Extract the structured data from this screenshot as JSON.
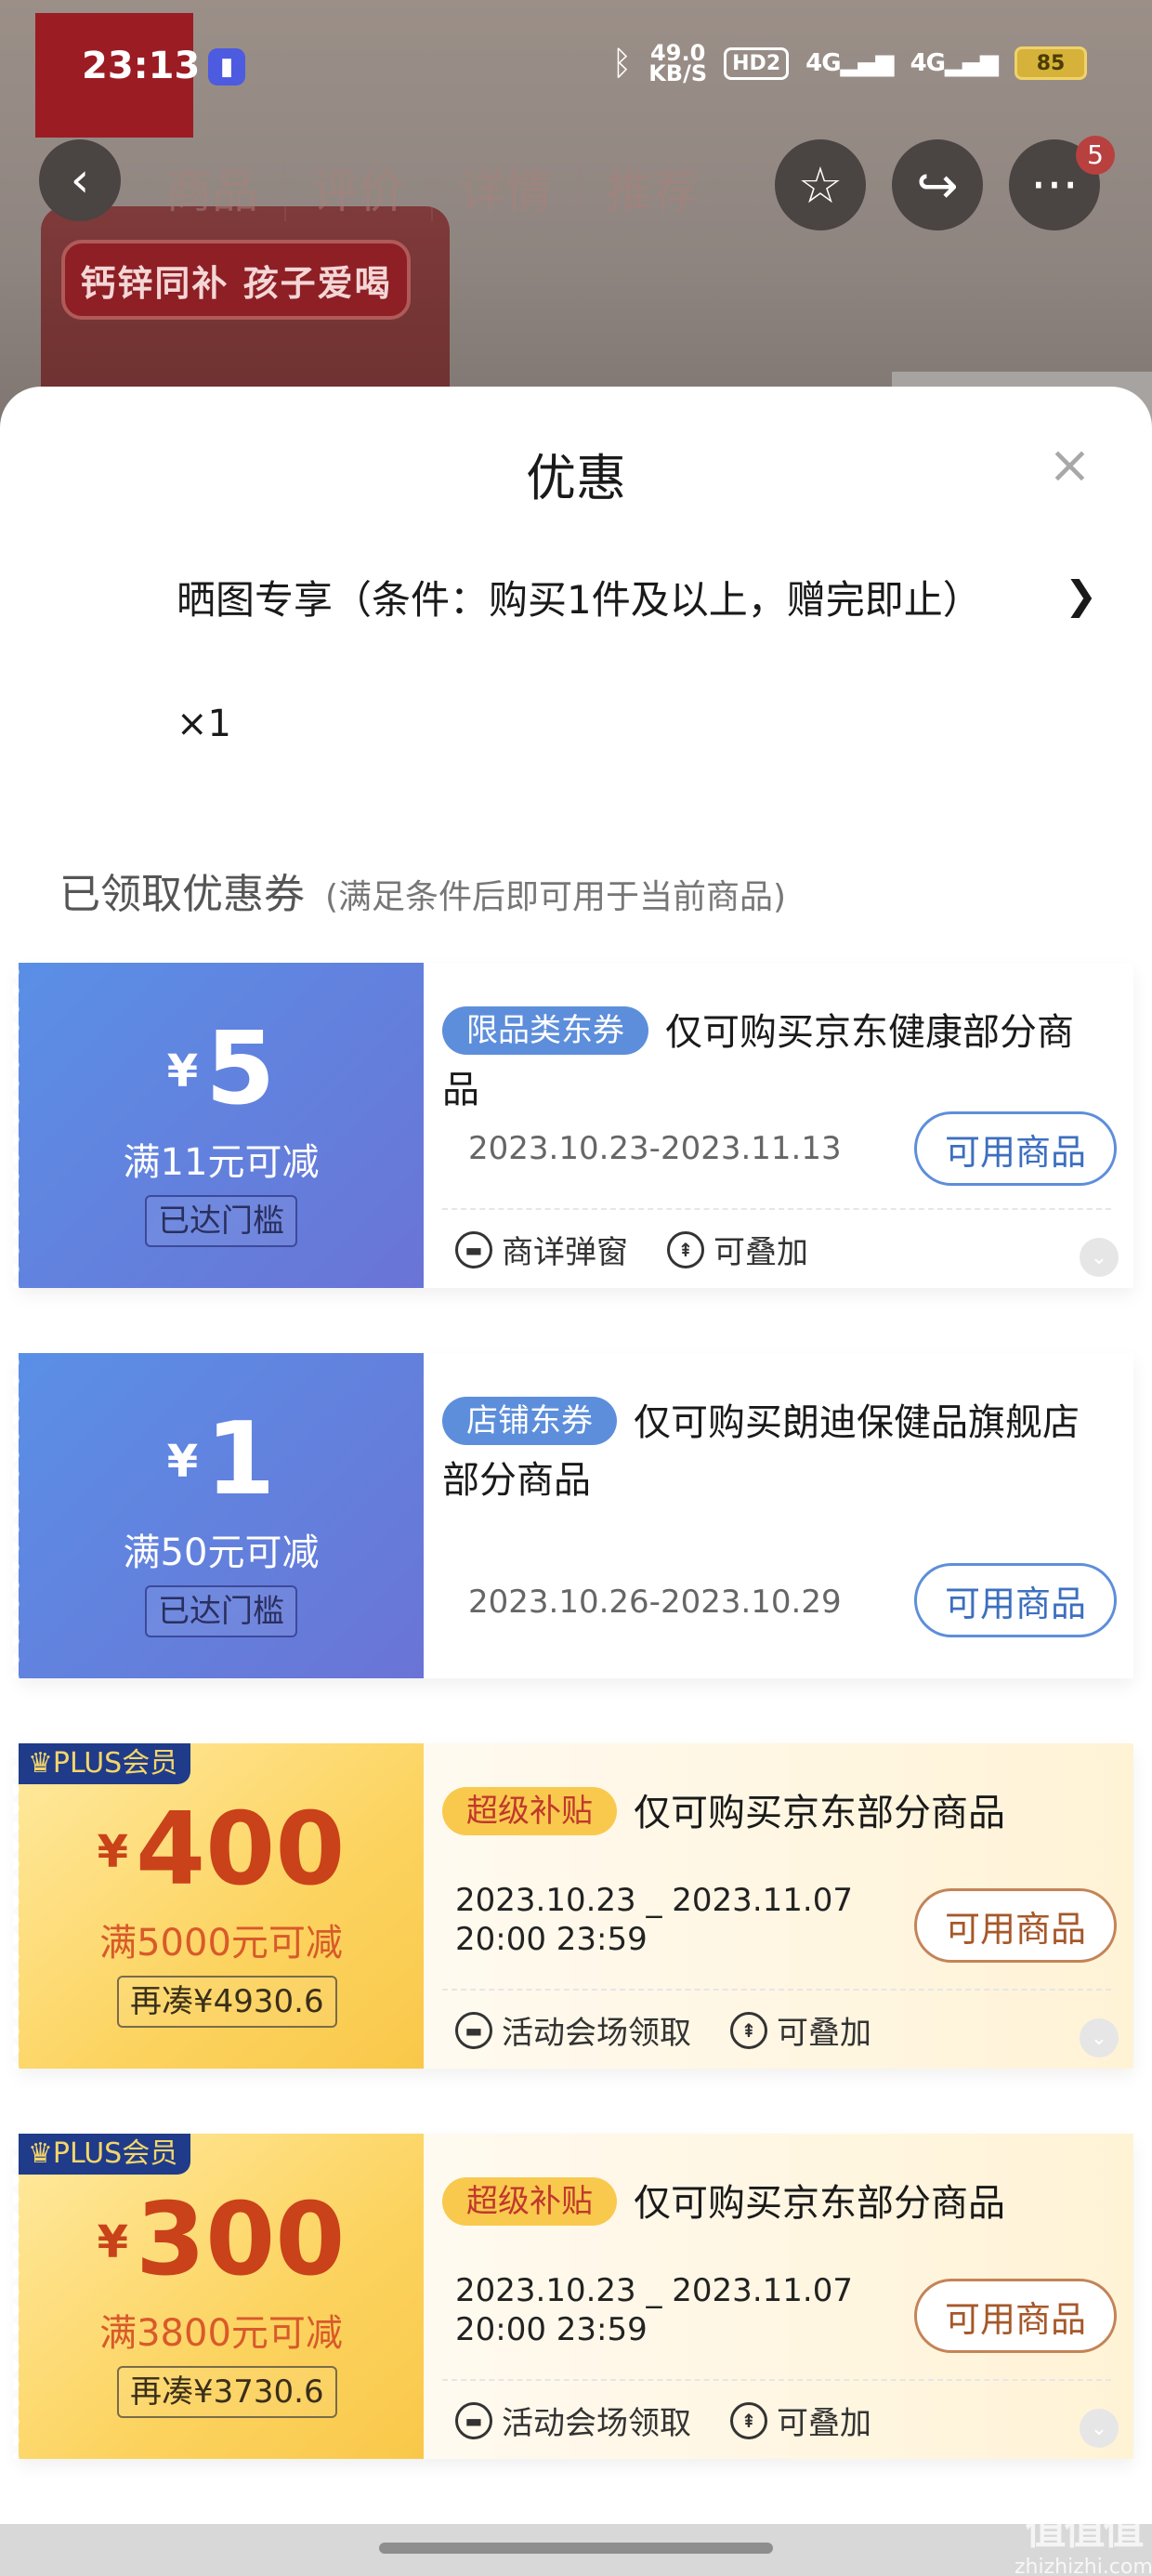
{
  "status_bar": {
    "time": "23:13",
    "speed_value": "49.0",
    "speed_unit": "KB/S",
    "hd_label": "HD2",
    "signal1": "4G",
    "signal2": "4G",
    "battery": "85"
  },
  "nav": {
    "tabs": [
      "商品",
      "评价",
      "详情",
      "推荐"
    ],
    "badge_count": "5"
  },
  "background_product": {
    "pill_text": "钙锌同补 孩子爱喝"
  },
  "sheet": {
    "title": "优惠",
    "close_icon": "×",
    "gift": {
      "text": "晒图专享（条件：购买1件及以上，赠完即止）",
      "qty": "×1"
    },
    "section": {
      "title": "已领取优惠券",
      "subtitle": "(满足条件后即可用于当前商品)"
    }
  },
  "coupons": [
    {
      "yen": "¥",
      "amount": "5",
      "condition": "满11元可减",
      "tag": "已达门槛",
      "label": "限品类东券",
      "desc": "仅可购买京东健康部分商品",
      "date": "2023.10.23-2023.11.13",
      "button": "可用商品",
      "features": [
        "商详弹窗",
        "可叠加"
      ]
    },
    {
      "yen": "¥",
      "amount": "1",
      "condition": "满50元可减",
      "tag": "已达门槛",
      "label": "店铺东券",
      "desc": "仅可购买朗迪保健品旗舰店部分商品",
      "date": "2023.10.26-2023.10.29",
      "button": "可用商品",
      "features": []
    },
    {
      "plus": "PLUS会员",
      "yen": "¥",
      "amount": "400",
      "condition": "满5000元可减",
      "tag": "再凑¥4930.6",
      "label": "超级补贴",
      "desc": "仅可购买京东部分商品",
      "date_line1": "2023.10.23 _ 2023.11.07",
      "date_line2": "20:00 23:59",
      "button": "可用商品",
      "features": [
        "活动会场领取",
        "可叠加"
      ]
    },
    {
      "plus": "PLUS会员",
      "yen": "¥",
      "amount": "300",
      "condition": "满3800元可减",
      "tag": "再凑¥3730.6",
      "label": "超级补贴",
      "desc": "仅可购买京东部分商品",
      "date_line1": "2023.10.23 _ 2023.11.07",
      "date_line2": "20:00 23:59",
      "button": "可用商品",
      "features": [
        "活动会场领取",
        "可叠加"
      ]
    }
  ],
  "watermark": {
    "big": "值值值",
    "small": "zhizhizhi.com"
  },
  "colors": {
    "blue_coupon": "#5a8fe6",
    "gold_coupon": "#fcd35f",
    "accent_red": "#c9421a"
  }
}
